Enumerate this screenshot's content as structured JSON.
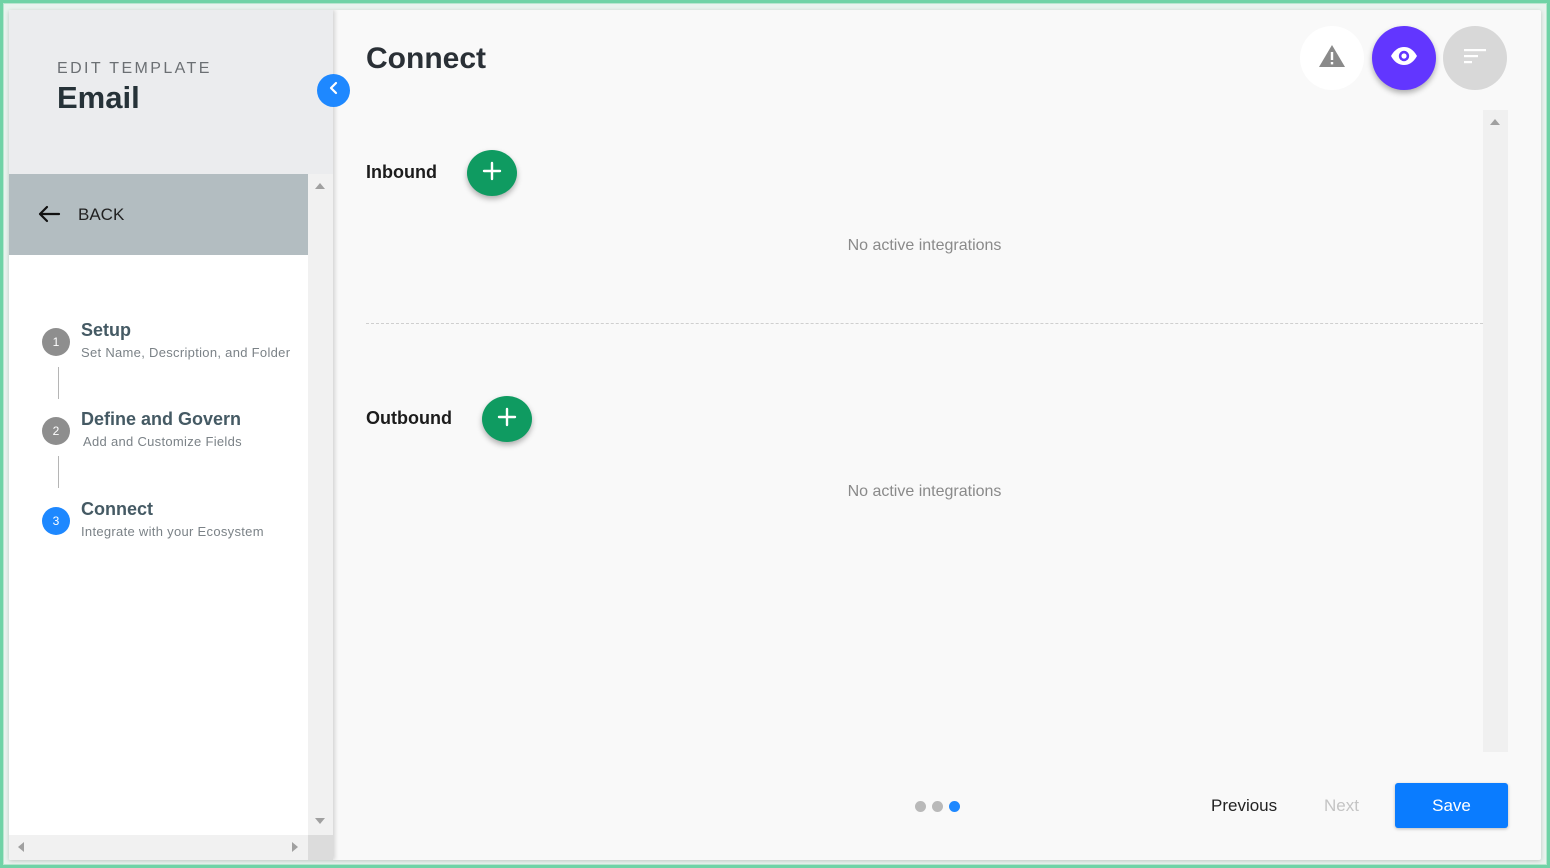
{
  "sidebar": {
    "eyebrow": "EDIT TEMPLATE",
    "title": "Email",
    "back_label": "BACK",
    "steps": [
      {
        "number": "1",
        "title": "Setup",
        "subtitle": "Set Name, Description, and Folder",
        "active": false
      },
      {
        "number": "2",
        "title": "Define and Govern",
        "subtitle": "Add and Customize Fields",
        "active": false
      },
      {
        "number": "3",
        "title": "Connect",
        "subtitle": "Integrate with your Ecosystem",
        "active": true
      }
    ]
  },
  "main": {
    "title": "Connect",
    "actions": [
      "warning-icon",
      "eye-icon",
      "sort-icon"
    ],
    "sections": [
      {
        "label": "Inbound",
        "empty_message": "No active integrations"
      },
      {
        "label": "Outbound",
        "empty_message": "No active integrations"
      }
    ]
  },
  "footer": {
    "pager": {
      "current": 3,
      "total": 3
    },
    "previous_label": "Previous",
    "next_label": "Next",
    "save_label": "Save"
  },
  "colors": {
    "accent_blue": "#1e88ff",
    "eye_purple": "#6236ff",
    "add_green": "#0f9b61",
    "save_blue": "#0a7cff"
  }
}
